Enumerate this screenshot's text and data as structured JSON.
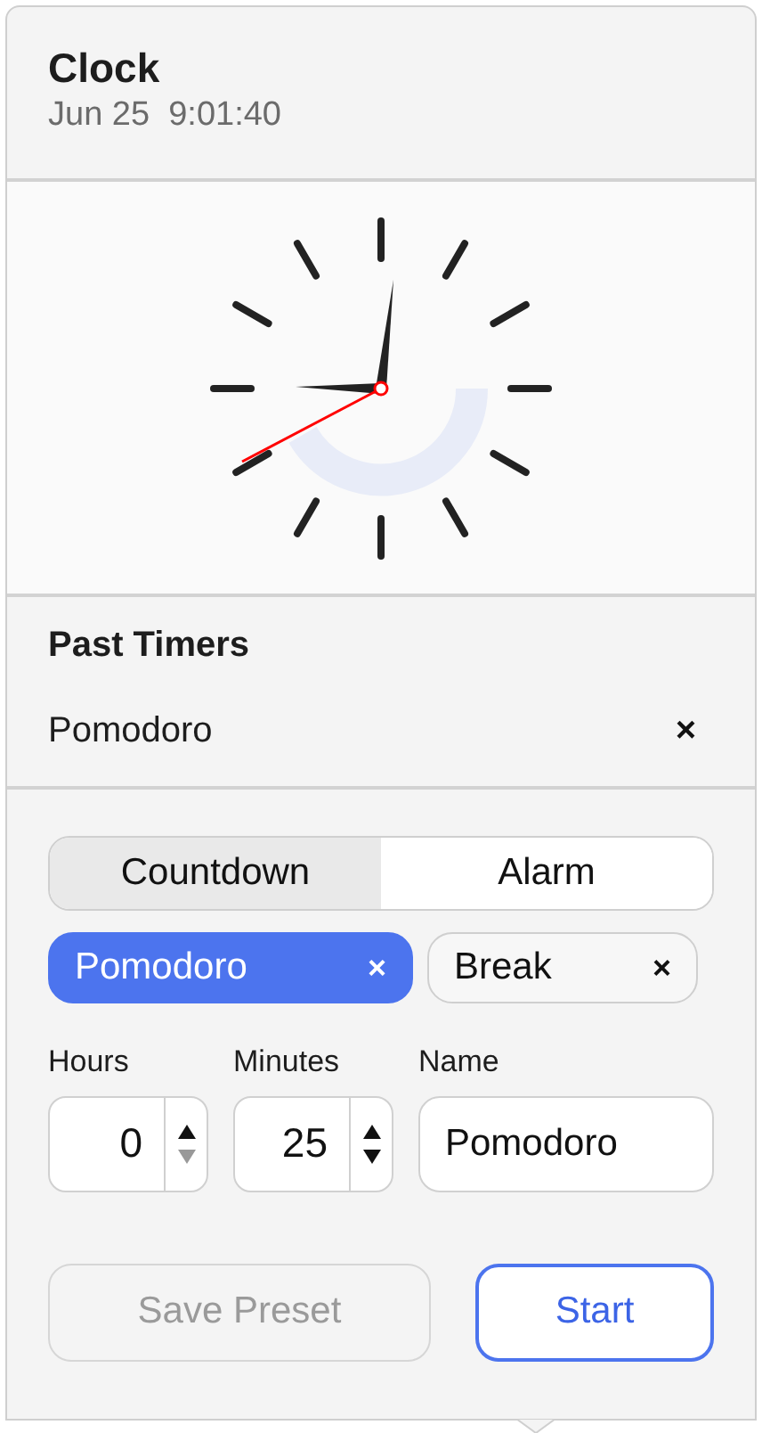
{
  "header": {
    "title": "Clock",
    "datetime": "Jun 25  9:01:40"
  },
  "past_timers": {
    "title": "Past Timers",
    "items": [
      {
        "name": "Pomodoro",
        "remove": "×"
      }
    ]
  },
  "mode_tabs": [
    {
      "label": "Countdown",
      "selected": true
    },
    {
      "label": "Alarm",
      "selected": false
    }
  ],
  "presets": [
    {
      "label": "Pomodoro",
      "remove": "×",
      "selected": true
    },
    {
      "label": "Break",
      "remove": "×",
      "selected": false
    }
  ],
  "fields": [
    {
      "kind": "stepper",
      "label": "Hours",
      "value": "0",
      "up_disabled": false,
      "down_disabled": true
    },
    {
      "kind": "stepper",
      "label": "Minutes",
      "value": "25",
      "up_disabled": false,
      "down_disabled": false
    },
    {
      "kind": "text",
      "label": "Name",
      "value": "Pomodoro"
    }
  ],
  "buttons": [
    {
      "label": "Save Preset",
      "disabled": true,
      "primary": false
    },
    {
      "label": "Start",
      "disabled": false,
      "primary": true
    }
  ]
}
